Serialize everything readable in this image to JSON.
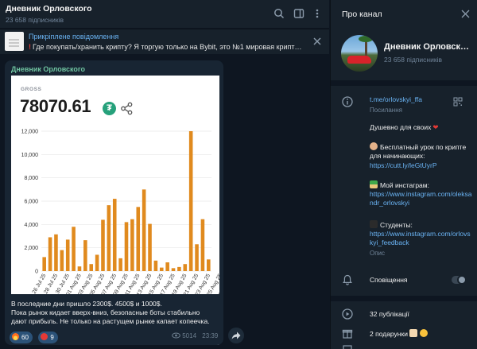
{
  "chat": {
    "title": "Дневник Орловского",
    "subscribers": "23 658 підписників",
    "pinned": {
      "title": "Прикріплене повідомлення",
      "text": "Где покупать/хранить крипту? Я торгую только на Bybit, это №1 мировая крипт…"
    },
    "message": {
      "author": "Дневник Орловского",
      "card": {
        "label": "GROSS",
        "value": "78070.61"
      },
      "text_lines": [
        "В последние дни пришло 2300$. 4500$ и 1000$.",
        "Пока рынок кидает вверх-вниз, безопасные боты стабильно",
        "дают прибыль. Не только на растущем рынке капает копеечка."
      ],
      "reactions": [
        {
          "icon": "fire-emoji",
          "count": "60"
        },
        {
          "icon": "heart-emoji",
          "count": "9"
        }
      ],
      "views": "5014",
      "time": "23:39"
    }
  },
  "panel": {
    "title": "Про канал",
    "channel_name": "Дневник Орловск…",
    "subscribers": "23 658 підписників",
    "link": "t.me/orlovskyi_ffa",
    "link_caption": "Посилання",
    "about": {
      "line1": "Душевно для своих",
      "lesson": "Бесплатный урок по крипте для начинающих:",
      "lesson_link": "https://cutt.ly/leGtUyrP",
      "insta_label": "Мой инстаграм:",
      "insta_link": "https://www.instagram.com/oleksandr_orlovskyi",
      "students_label": "Студенты:",
      "students_link": "https://www.instagram.com/orlovskyi_feedback"
    },
    "about_caption": "Опис",
    "notifications_label": "Сповіщення",
    "posts": "32 публікації",
    "gifts": "2 подарунки"
  },
  "colors": {
    "bar": "#e08a1e",
    "accent_link": "#6ab3f3",
    "author": "#6fc3a0",
    "bg": "#0e1621",
    "panel": "#17212b"
  },
  "chart_data": {
    "type": "bar",
    "ylim": [
      0,
      12000
    ],
    "yticks": [
      "0",
      "2,000",
      "4,000",
      "6,000",
      "8,000",
      "10,000",
      "12,000"
    ],
    "x_ticks": [
      "26 Jul 25",
      "28 Jul 25",
      "30 Jul 25",
      "01 Aug 25",
      "03 Aug 25",
      "05 Aug 25",
      "07 Aug 25",
      "09 Aug 25",
      "11 Aug 25",
      "13 Aug 25",
      "15 Aug 25",
      "17 Aug 25",
      "19 Aug 25",
      "21 Aug 25",
      "23 Aug 25",
      "25 Aug 25",
      "27 Aug 25"
    ],
    "values": [
      1200,
      2900,
      3150,
      1800,
      2700,
      3800,
      400,
      2650,
      600,
      1400,
      4400,
      5650,
      6200,
      1100,
      4200,
      4450,
      5500,
      7000,
      4050,
      900,
      300,
      750,
      250,
      350,
      600,
      12000,
      2300,
      4450,
      1000
    ]
  }
}
